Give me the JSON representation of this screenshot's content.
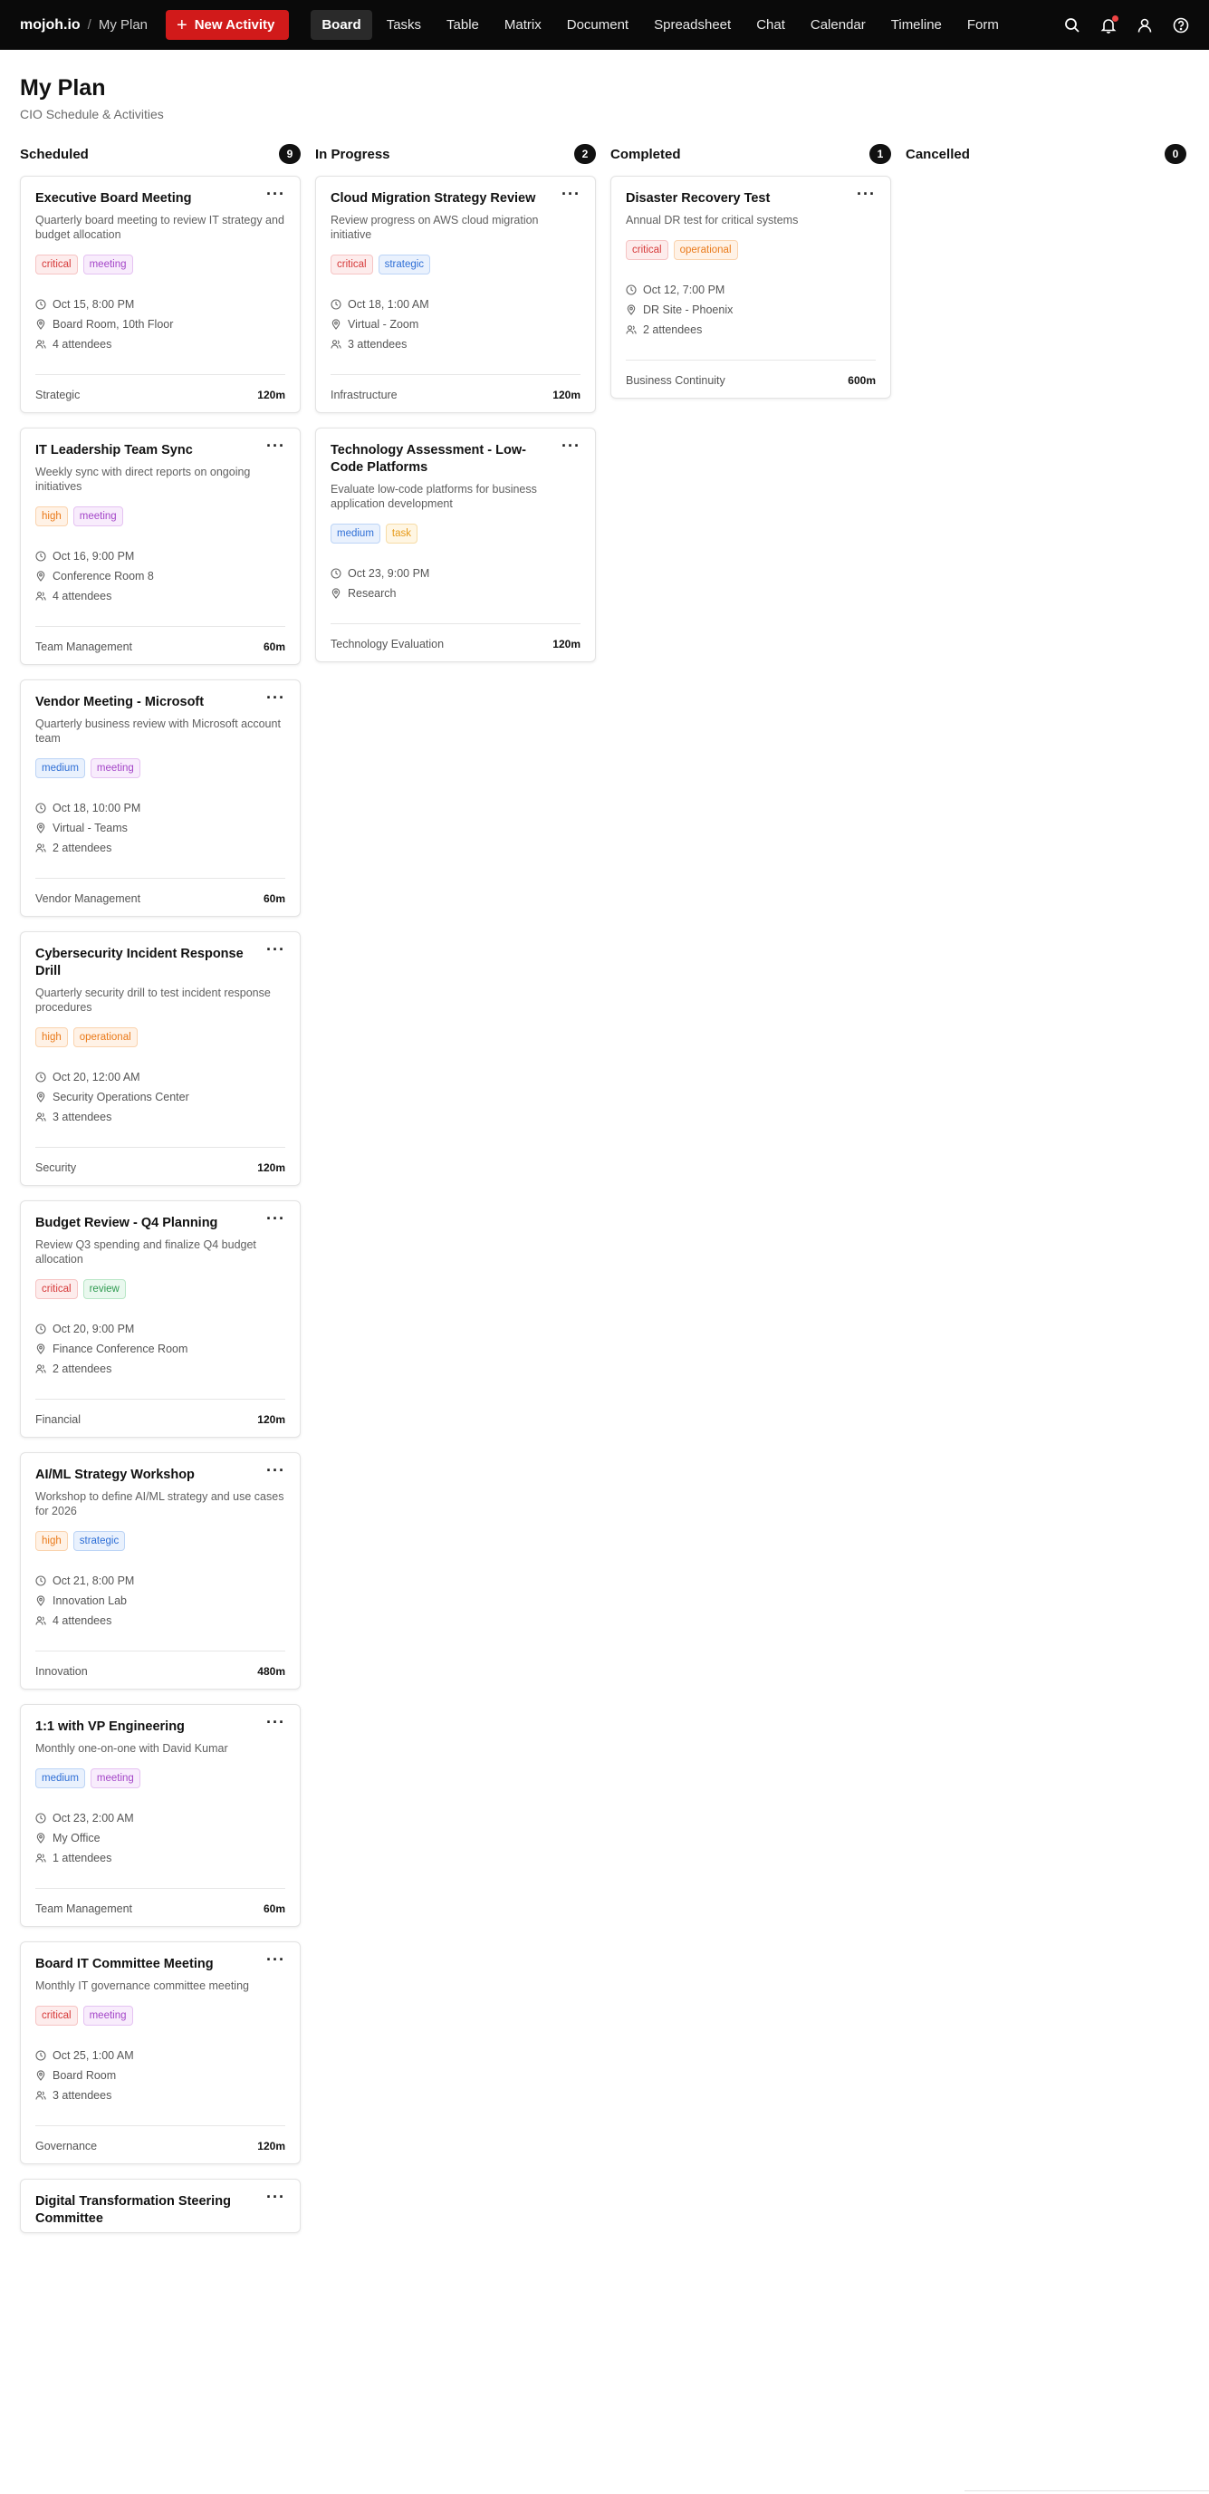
{
  "nav": {
    "brand": "mojoh.io",
    "separator": "/",
    "crumb": "My Plan",
    "new_activity": "New Activity",
    "tabs": [
      {
        "label": "Board",
        "active": true
      },
      {
        "label": "Tasks"
      },
      {
        "label": "Table"
      },
      {
        "label": "Matrix"
      },
      {
        "label": "Document"
      },
      {
        "label": "Spreadsheet"
      },
      {
        "label": "Chat"
      },
      {
        "label": "Calendar"
      },
      {
        "label": "Timeline"
      },
      {
        "label": "Form"
      }
    ],
    "icons": [
      "search-icon",
      "bell-icon",
      "user-icon",
      "help-icon"
    ],
    "accent": "#d11a1a"
  },
  "header": {
    "title": "My Plan",
    "subtitle": "CIO Schedule & Activities"
  },
  "columns": [
    {
      "title": "Scheduled",
      "count": "9",
      "cards": [
        {
          "title": "Executive Board Meeting",
          "description": "Quarterly board meeting to review IT strategy and budget allocation",
          "tags": [
            "critical",
            "meeting"
          ],
          "date": "Oct 15, 8:00 PM",
          "location": "Board Room, 10th Floor",
          "attendees": "4 attendees",
          "category": "Strategic",
          "duration": "120m"
        },
        {
          "title": "IT Leadership Team Sync",
          "description": "Weekly sync with direct reports on ongoing initiatives",
          "tags": [
            "high",
            "meeting"
          ],
          "date": "Oct 16, 9:00 PM",
          "location": "Conference Room 8",
          "attendees": "4 attendees",
          "category": "Team Management",
          "duration": "60m"
        },
        {
          "title": "Vendor Meeting - Microsoft",
          "description": "Quarterly business review with Microsoft account team",
          "tags": [
            "medium",
            "meeting"
          ],
          "date": "Oct 18, 10:00 PM",
          "location": "Virtual - Teams",
          "attendees": "2 attendees",
          "category": "Vendor Management",
          "duration": "60m"
        },
        {
          "title": "Cybersecurity Incident Response Drill",
          "description": "Quarterly security drill to test incident response procedures",
          "tags": [
            "high",
            "operational"
          ],
          "date": "Oct 20, 12:00 AM",
          "location": "Security Operations Center",
          "attendees": "3 attendees",
          "category": "Security",
          "duration": "120m"
        },
        {
          "title": "Budget Review - Q4 Planning",
          "description": "Review Q3 spending and finalize Q4 budget allocation",
          "tags": [
            "critical",
            "review"
          ],
          "date": "Oct 20, 9:00 PM",
          "location": "Finance Conference Room",
          "attendees": "2 attendees",
          "category": "Financial",
          "duration": "120m"
        },
        {
          "title": "AI/ML Strategy Workshop",
          "description": "Workshop to define AI/ML strategy and use cases for 2026",
          "tags": [
            "high",
            "strategic"
          ],
          "date": "Oct 21, 8:00 PM",
          "location": "Innovation Lab",
          "attendees": "4 attendees",
          "category": "Innovation",
          "duration": "480m"
        },
        {
          "title": "1:1 with VP Engineering",
          "description": "Monthly one-on-one with David Kumar",
          "tags": [
            "medium",
            "meeting"
          ],
          "date": "Oct 23, 2:00 AM",
          "location": "My Office",
          "attendees": "1 attendees",
          "category": "Team Management",
          "duration": "60m"
        },
        {
          "title": "Board IT Committee Meeting",
          "description": "Monthly IT governance committee meeting",
          "tags": [
            "critical",
            "meeting"
          ],
          "date": "Oct 25, 1:00 AM",
          "location": "Board Room",
          "attendees": "3 attendees",
          "category": "Governance",
          "duration": "120m"
        },
        {
          "title": "Digital Transformation Steering Committee",
          "partial": true
        }
      ]
    },
    {
      "title": "In Progress",
      "count": "2",
      "cards": [
        {
          "title": "Cloud Migration Strategy Review",
          "description": "Review progress on AWS cloud migration initiative",
          "tags": [
            "critical",
            "strategic"
          ],
          "date": "Oct 18, 1:00 AM",
          "location": "Virtual - Zoom",
          "attendees": "3 attendees",
          "category": "Infrastructure",
          "duration": "120m"
        },
        {
          "title": "Technology Assessment - Low-Code Platforms",
          "description": "Evaluate low-code platforms for business application development",
          "tags": [
            "medium",
            "task"
          ],
          "date": "Oct 23, 9:00 PM",
          "location": "Research",
          "category": "Technology Evaluation",
          "duration": "120m"
        }
      ]
    },
    {
      "title": "Completed",
      "count": "1",
      "cards": [
        {
          "title": "Disaster Recovery Test",
          "description": "Annual DR test for critical systems",
          "tags": [
            "critical",
            "operational"
          ],
          "date": "Oct 12, 7:00 PM",
          "location": "DR Site - Phoenix",
          "attendees": "2 attendees",
          "category": "Business Continuity",
          "duration": "600m"
        }
      ]
    },
    {
      "title": "Cancelled",
      "count": "0",
      "cards": []
    }
  ]
}
